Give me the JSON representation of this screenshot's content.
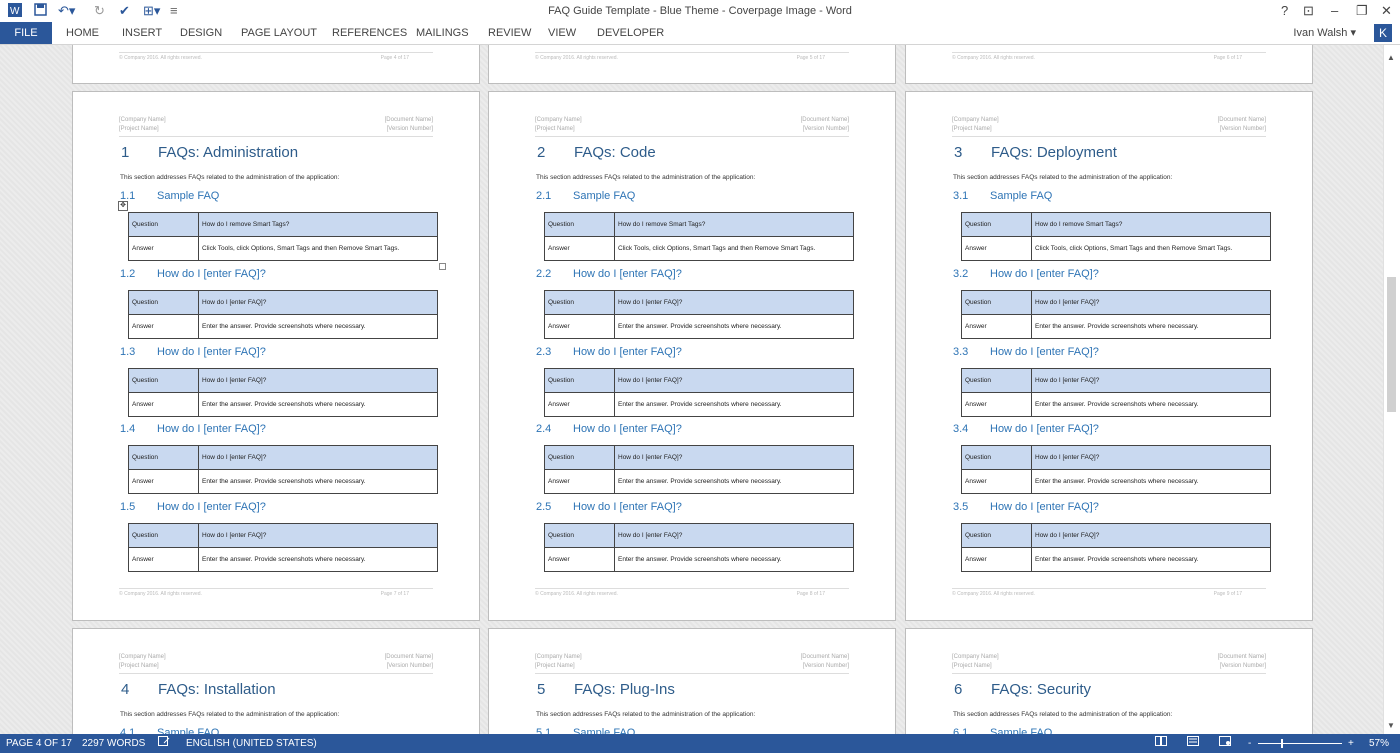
{
  "titlebar": {
    "title": "FAQ Guide Template - Blue Theme - Coverpage Image - Word",
    "quick_access": [
      "word-logo-icon",
      "save-icon",
      "undo-icon",
      "redo-icon",
      "spelling-icon",
      "touch-mode-icon",
      "customize-icon"
    ],
    "controls": {
      "help": "?",
      "ribbon_display": "⊡",
      "minimize": "–",
      "restore": "❐",
      "close": "✕"
    }
  },
  "ribbon": {
    "file": "FILE",
    "tabs": [
      "HOME",
      "INSERT",
      "DESIGN",
      "PAGE LAYOUT",
      "REFERENCES",
      "MAILINGS",
      "REVIEW",
      "VIEW",
      "DEVELOPER"
    ],
    "user": "Ivan Walsh ▾",
    "user_initial": "K"
  },
  "pages_top": [
    {
      "footer_left": "© Company 2016. All rights reserved.",
      "footer_right": "Page 4 of 17"
    },
    {
      "footer_left": "© Company 2016. All rights reserved.",
      "footer_right": "Page 5 of 17"
    },
    {
      "footer_left": "© Company 2016. All rights reserved.",
      "footer_right": "Page 6 of 17"
    }
  ],
  "pages": [
    {
      "header": {
        "company": "[Company Name]",
        "project": "[Project Name]",
        "document": "[Document Name]",
        "version": "[Version Number]"
      },
      "chapter_num": "1",
      "chapter_title": "FAQs: Administration",
      "intro": "This section addresses FAQs related to the administration of the application:",
      "sections": [
        {
          "num": "1.1",
          "title": "Sample FAQ",
          "q_label": "Question",
          "q": "How do I remove Smart Tags?",
          "a_label": "Answer",
          "a": "Click Tools, click Options, Smart Tags and then Remove Smart Tags."
        },
        {
          "num": "1.2",
          "title": "How do I [enter FAQ]?",
          "q_label": "Question",
          "q": "How do I [enter FAQ]?",
          "a_label": "Answer",
          "a": "Enter the answer. Provide screenshots where necessary."
        },
        {
          "num": "1.3",
          "title": "How do I [enter FAQ]?",
          "q_label": "Question",
          "q": "How do I [enter FAQ]?",
          "a_label": "Answer",
          "a": "Enter the answer. Provide screenshots where necessary."
        },
        {
          "num": "1.4",
          "title": "How do I [enter FAQ]?",
          "q_label": "Question",
          "q": "How do I [enter FAQ]?",
          "a_label": "Answer",
          "a": "Enter the answer. Provide screenshots where necessary."
        },
        {
          "num": "1.5",
          "title": "How do I [enter FAQ]?",
          "q_label": "Question",
          "q": "How do I [enter FAQ]?",
          "a_label": "Answer",
          "a": "Enter the answer. Provide screenshots where necessary."
        }
      ],
      "footer_left": "© Company 2016. All rights reserved.",
      "footer_right": "Page 7 of 17"
    },
    {
      "header": {
        "company": "[Company Name]",
        "project": "[Project Name]",
        "document": "[Document Name]",
        "version": "[Version Number]"
      },
      "chapter_num": "2",
      "chapter_title": "FAQs: Code",
      "intro": "This section addresses FAQs related to the administration of the application:",
      "sections": [
        {
          "num": "2.1",
          "title": "Sample FAQ",
          "q_label": "Question",
          "q": "How do I remove Smart Tags?",
          "a_label": "Answer",
          "a": "Click Tools, click Options, Smart Tags and then Remove Smart Tags."
        },
        {
          "num": "2.2",
          "title": "How do I [enter FAQ]?",
          "q_label": "Question",
          "q": "How do I [enter FAQ]?",
          "a_label": "Answer",
          "a": "Enter the answer. Provide screenshots where necessary."
        },
        {
          "num": "2.3",
          "title": "How do I [enter FAQ]?",
          "q_label": "Question",
          "q": "How do I [enter FAQ]?",
          "a_label": "Answer",
          "a": "Enter the answer. Provide screenshots where necessary."
        },
        {
          "num": "2.4",
          "title": "How do I [enter FAQ]?",
          "q_label": "Question",
          "q": "How do I [enter FAQ]?",
          "a_label": "Answer",
          "a": "Enter the answer. Provide screenshots where necessary."
        },
        {
          "num": "2.5",
          "title": "How do I [enter FAQ]?",
          "q_label": "Question",
          "q": "How do I [enter FAQ]?",
          "a_label": "Answer",
          "a": "Enter the answer. Provide screenshots where necessary."
        }
      ],
      "footer_left": "© Company 2016. All rights reserved.",
      "footer_right": "Page 8 of 17"
    },
    {
      "header": {
        "company": "[Company Name]",
        "project": "[Project Name]",
        "document": "[Document Name]",
        "version": "[Version Number]"
      },
      "chapter_num": "3",
      "chapter_title": "FAQs: Deployment",
      "intro": "This section addresses FAQs related to the administration of the application:",
      "sections": [
        {
          "num": "3.1",
          "title": "Sample FAQ",
          "q_label": "Question",
          "q": "How do I remove Smart Tags?",
          "a_label": "Answer",
          "a": "Click Tools, click Options, Smart Tags and then Remove Smart Tags."
        },
        {
          "num": "3.2",
          "title": "How do I [enter FAQ]?",
          "q_label": "Question",
          "q": "How do I [enter FAQ]?",
          "a_label": "Answer",
          "a": "Enter the answer. Provide screenshots where necessary."
        },
        {
          "num": "3.3",
          "title": "How do I [enter FAQ]?",
          "q_label": "Question",
          "q": "How do I [enter FAQ]?",
          "a_label": "Answer",
          "a": "Enter the answer. Provide screenshots where necessary."
        },
        {
          "num": "3.4",
          "title": "How do I [enter FAQ]?",
          "q_label": "Question",
          "q": "How do I [enter FAQ]?",
          "a_label": "Answer",
          "a": "Enter the answer. Provide screenshots where necessary."
        },
        {
          "num": "3.5",
          "title": "How do I [enter FAQ]?",
          "q_label": "Question",
          "q": "How do I [enter FAQ]?",
          "a_label": "Answer",
          "a": "Enter the answer. Provide screenshots where necessary."
        }
      ],
      "footer_left": "© Company 2016. All rights reserved.",
      "footer_right": "Page 9 of 17"
    }
  ],
  "pages_bottom": [
    {
      "header": {
        "company": "[Company Name]",
        "project": "[Project Name]",
        "document": "[Document Name]",
        "version": "[Version Number]"
      },
      "chapter_num": "4",
      "chapter_title": "FAQs: Installation",
      "intro": "This section addresses FAQs related to the administration of the application:",
      "first_num": "4.1",
      "first_title": "Sample FAQ"
    },
    {
      "header": {
        "company": "[Company Name]",
        "project": "[Project Name]",
        "document": "[Document Name]",
        "version": "[Version Number]"
      },
      "chapter_num": "5",
      "chapter_title": "FAQs: Plug-Ins",
      "intro": "This section addresses FAQs related to the administration of the application:",
      "first_num": "5.1",
      "first_title": "Sample FAQ"
    },
    {
      "header": {
        "company": "[Company Name]",
        "project": "[Project Name]",
        "document": "[Document Name]",
        "version": "[Version Number]"
      },
      "chapter_num": "6",
      "chapter_title": "FAQs: Security",
      "intro": "This section addresses FAQs related to the administration of the application:",
      "first_num": "6.1",
      "first_title": "Sample FAQ"
    }
  ],
  "statusbar": {
    "page": "PAGE 4 OF 17",
    "words": "2297 WORDS",
    "proofing_icon": "proofing-icon",
    "language": "ENGLISH (UNITED STATES)",
    "zoom_minus": "-",
    "zoom_plus": "+",
    "zoom": "57%",
    "zoom_level_fraction": 0.27
  },
  "colors": {
    "brand": "#2b579a",
    "heading": "#2e5c8a",
    "table_header": "#c9d9f0"
  }
}
